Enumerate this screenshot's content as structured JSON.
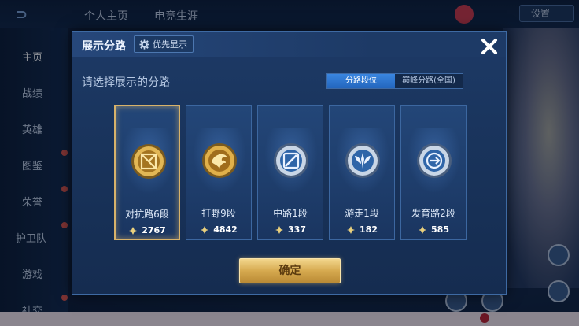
{
  "background": {
    "top_tabs": [
      "个人主页",
      "电竞生涯"
    ],
    "sidebar": [
      "主页",
      "战绩",
      "英雄",
      "图鉴",
      "荣誉",
      "护卫队",
      "游戏",
      "社交"
    ],
    "dropdown": "设置"
  },
  "dialog": {
    "title": "展示分路",
    "priority_button": "优先显示",
    "subtitle": "请选择展示的分路",
    "toggle": [
      "分路段位",
      "巅峰分路(全国)"
    ],
    "toggle_active": 0,
    "confirm": "确定",
    "cards": [
      {
        "label": "对抗路6段",
        "score": "2767",
        "selected": true,
        "badge_icon": "gold-sword-badge-icon"
      },
      {
        "label": "打野9段",
        "score": "4842",
        "selected": false,
        "badge_icon": "gold-dragon-badge-icon"
      },
      {
        "label": "中路1段",
        "score": "337",
        "selected": false,
        "badge_icon": "silver-mid-badge-icon"
      },
      {
        "label": "游走1段",
        "score": "182",
        "selected": false,
        "badge_icon": "silver-support-badge-icon"
      },
      {
        "label": "发育路2段",
        "score": "585",
        "selected": false,
        "badge_icon": "silver-adc-badge-icon"
      }
    ]
  },
  "colors": {
    "gold": "#d7b26a",
    "accent_blue": "#2f78d4",
    "panel": "#1b3660"
  }
}
